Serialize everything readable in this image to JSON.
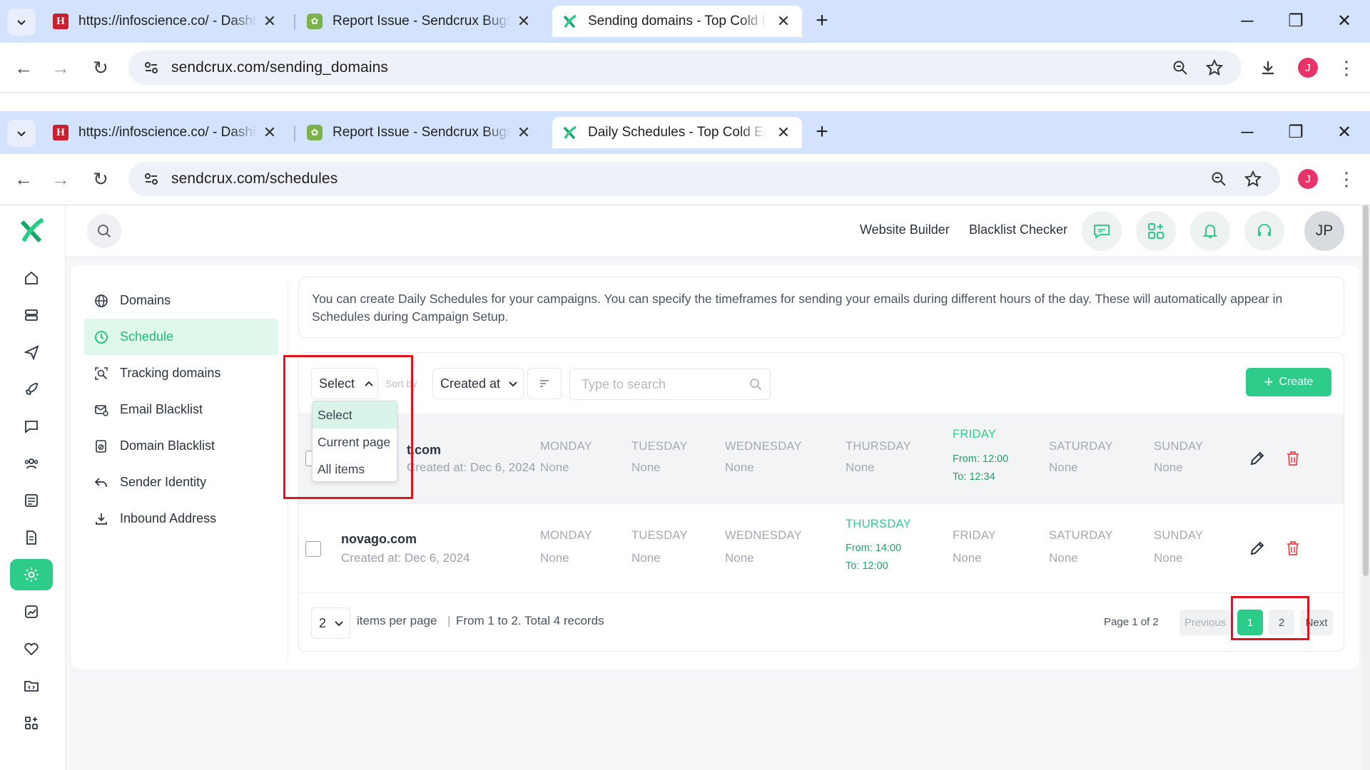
{
  "browser_back": {
    "tabs": [
      {
        "title": "https://infoscience.co/ - Dashboard"
      },
      {
        "title": "Report Issue - Sendcrux Bugs Tracker"
      },
      {
        "title": "Sending domains - Top Cold Email"
      }
    ],
    "url": "sendcrux.com/sending_domains"
  },
  "browser_front": {
    "tabs": [
      {
        "title": "https://infoscience.co/ - Dashboard"
      },
      {
        "title": "Report Issue - Sendcrux Bugs Tracker"
      },
      {
        "title": "Daily Schedules - Top Cold Email"
      }
    ],
    "url": "sendcrux.com/schedules",
    "profile_initial": "J"
  },
  "topbar": {
    "links": [
      "Website Builder",
      "Blacklist Checker"
    ],
    "user_initials": "JP"
  },
  "settings_menu": [
    {
      "label": "Domains",
      "icon": "globe-icon"
    },
    {
      "label": "Schedule",
      "icon": "clock-icon",
      "active": true
    },
    {
      "label": "Tracking domains",
      "icon": "tracking-search-icon"
    },
    {
      "label": "Email Blacklist",
      "icon": "mail-block-icon"
    },
    {
      "label": "Domain Blacklist",
      "icon": "domain-block-icon"
    },
    {
      "label": "Sender Identity",
      "icon": "reply-icon"
    },
    {
      "label": "Inbound Address",
      "icon": "download-tray-icon"
    }
  ],
  "info_text": "You can create Daily Schedules for your campaigns. You can specify the timeframes for sending your emails during different hours of the day. These will automatically appear in Schedules during Campaign Setup.",
  "filters": {
    "select_label": "Select",
    "sort_label": "Sort by",
    "sort_value": "Created at",
    "search_placeholder": "Type to search",
    "create_label": "Create"
  },
  "select_dropdown": [
    "Select",
    "Current page",
    "All items"
  ],
  "schedules": [
    {
      "name": "t.com",
      "created": "Created at: Dec 6, 2024",
      "days": [
        {
          "day": "MONDAY",
          "value": "None"
        },
        {
          "day": "TUESDAY",
          "value": "None"
        },
        {
          "day": "WEDNESDAY",
          "value": "None"
        },
        {
          "day": "THURSDAY",
          "value": "None"
        },
        {
          "day": "FRIDAY",
          "from": "From: 12:00",
          "to": "To: 12:34"
        },
        {
          "day": "SATURDAY",
          "value": "None"
        },
        {
          "day": "SUNDAY",
          "value": "None"
        }
      ]
    },
    {
      "name": "novago.com",
      "created": "Created at: Dec 6, 2024",
      "days": [
        {
          "day": "MONDAY",
          "value": "None"
        },
        {
          "day": "TUESDAY",
          "value": "None"
        },
        {
          "day": "WEDNESDAY",
          "value": "None"
        },
        {
          "day": "THURSDAY",
          "from": "From: 14:00",
          "to": "To: 12:00"
        },
        {
          "day": "FRIDAY",
          "value": "None"
        },
        {
          "day": "SATURDAY",
          "value": "None"
        },
        {
          "day": "SUNDAY",
          "value": "None"
        }
      ]
    }
  ],
  "pagination": {
    "per_page": "2",
    "per_page_label": "items per page",
    "range_text": "From 1 to 2. Total 4 records",
    "page_text": "Page 1 of 2",
    "previous": "Previous",
    "pages": [
      "1",
      "2"
    ],
    "next": "Next"
  },
  "colors": {
    "accent": "#2ecc8a",
    "delete": "#e5484d",
    "highlight_box": "#e0141e"
  }
}
